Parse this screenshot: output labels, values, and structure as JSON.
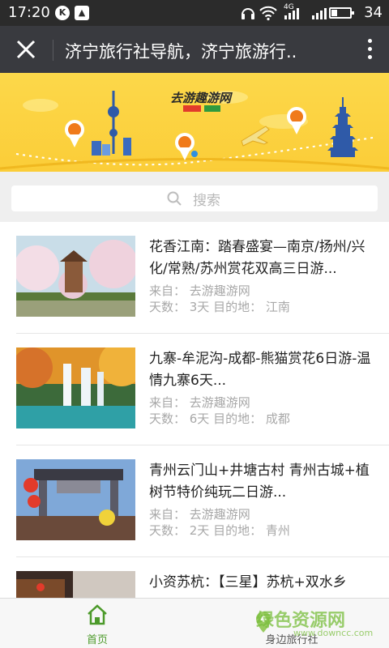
{
  "status_bar": {
    "time": "17:20",
    "battery_pct": "34",
    "battery_level": 0.34,
    "network": "4G"
  },
  "app_bar": {
    "title": "济宁旅行社导航，济宁旅游行.."
  },
  "banner": {
    "logo_text": "去游趣游网"
  },
  "search": {
    "placeholder": "搜索"
  },
  "list": {
    "items": [
      {
        "title": "花香江南：踏春盛宴—南京/扬州/兴化/常熟/苏州赏花双高三日游...",
        "source": "来自：  去游趣游网",
        "meta": "天数：  3天  目的地：  江南",
        "thumb": "cherry-blossom-pagoda"
      },
      {
        "title": "九寨-牟泥沟-成都-熊猫赏花6日游-温情九寨6天...",
        "source": "来自：  去游趣游网",
        "meta": "天数：  6天  目的地：  成都",
        "thumb": "waterfall-autumn"
      },
      {
        "title": "青州云门山+井塘古村 青州古城+植树节特价纯玩二日游...",
        "source": "来自：  去游趣游网",
        "meta": "天数：  2天  目的地：  青州",
        "thumb": "ancient-gate-lanterns"
      },
      {
        "title": "小资苏杭：【三星】苏杭+双水乡",
        "source": "",
        "meta": "",
        "thumb": "water-town"
      }
    ]
  },
  "tabs": {
    "home": "首页",
    "nearby": "身边旅行社"
  },
  "watermark": {
    "main": "绿色资源网",
    "sub": "www.downcc.com"
  },
  "colors": {
    "appbar": "#393a3f",
    "banner": "#fbcd38",
    "accent_green": "#4c9a2a"
  }
}
